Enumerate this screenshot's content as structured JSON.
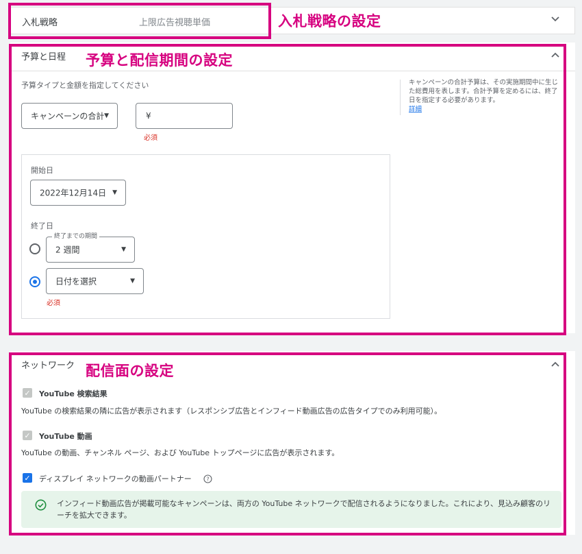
{
  "bidding": {
    "label": "入札戦略",
    "value": "上限広告視聴単価",
    "annotation": "入札戦略の設定"
  },
  "budget": {
    "section_title": "予算と日程",
    "annotation": "予算と配信期間の設定",
    "prompt": "予算タイプと金額を指定してください",
    "type_select": "キャンペーンの合計",
    "amount_prefix": "¥",
    "required": "必須",
    "help_text": "キャンペーンの合計予算は、その実施期間中に生じた総費用を表します。合計予算を定めるには、終了日を指定する必要があります。",
    "help_link": "詳細"
  },
  "schedule": {
    "start_label": "開始日",
    "start_value": "2022年12月14日",
    "end_label": "終了日",
    "duration_legend": "終了までの期間",
    "duration_value": "2 週間",
    "date_picker": "日付を選択",
    "required": "必須"
  },
  "network": {
    "section_title": "ネットワーク",
    "annotation": "配信面の設定",
    "search_label": "YouTube 検索結果",
    "search_desc": "YouTube の検索結果の隣に広告が表示されます（レスポンシブ広告とインフィード動画広告の広告タイプでのみ利用可能）。",
    "video_label": "YouTube 動画",
    "video_desc": "YouTube の動画、チャンネル ページ、および YouTube トップページに広告が表示されます。",
    "display_label": "ディスプレイ ネットワークの動画パートナー",
    "info_text": "インフィード動画広告が掲載可能なキャンペーンは、両方の YouTube ネットワークで配信されるようになりました。これにより、見込み顧客のリーチを拡大できます。"
  },
  "colors": {
    "annotation": "#d6007f",
    "accent": "#1a73e8",
    "info_bg": "#e6f4ea",
    "success_icon": "#1e8e3e"
  },
  "icons": [
    "chevron-down-icon",
    "chevron-up-icon",
    "dropdown-arrow-icon",
    "help-circle-icon",
    "check-circle-icon",
    "checkmark-icon"
  ]
}
